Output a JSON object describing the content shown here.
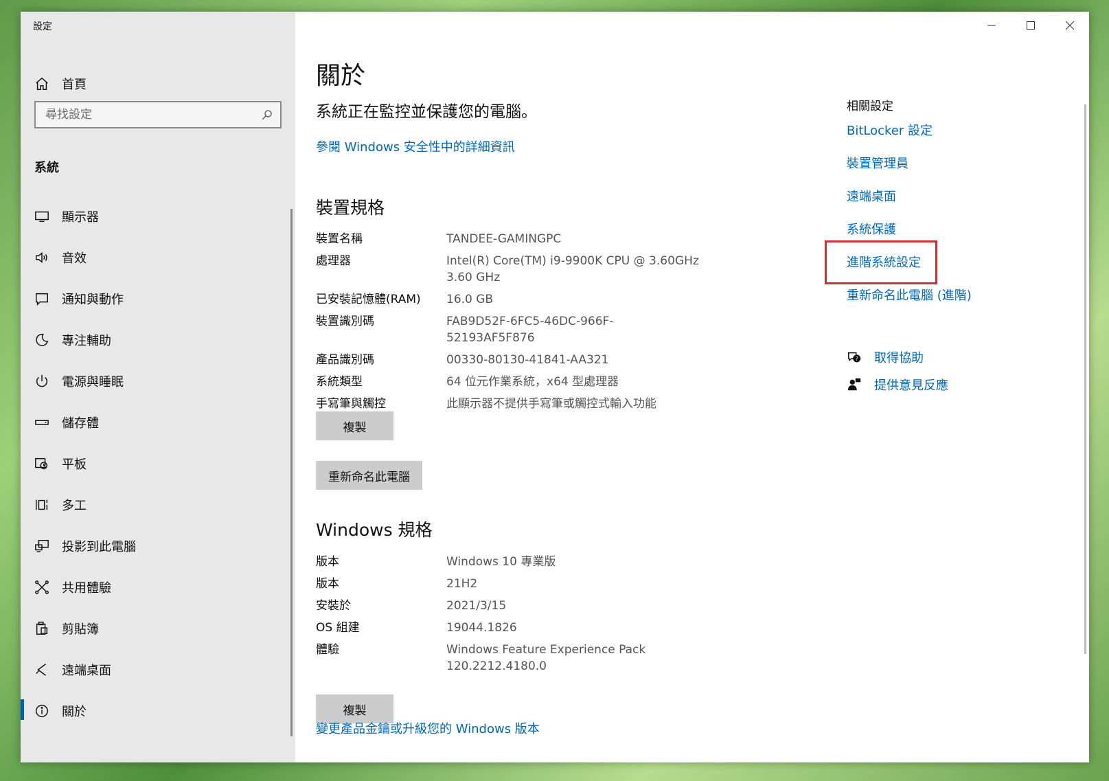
{
  "window": {
    "app_title": "設定",
    "controls": [
      "minimize-icon",
      "maximize-icon",
      "close-icon"
    ]
  },
  "sidebar": {
    "home_label": "首頁",
    "search_placeholder": "尋找設定",
    "section_title": "系統",
    "items": [
      {
        "label": "顯示器",
        "icon": "monitor-icon"
      },
      {
        "label": "音效",
        "icon": "speaker-icon"
      },
      {
        "label": "通知與動作",
        "icon": "notification-icon"
      },
      {
        "label": "專注輔助",
        "icon": "moon-icon"
      },
      {
        "label": "電源與睡眠",
        "icon": "power-icon"
      },
      {
        "label": "儲存體",
        "icon": "storage-icon"
      },
      {
        "label": "平板",
        "icon": "tablet-icon"
      },
      {
        "label": "多工",
        "icon": "multitask-icon"
      },
      {
        "label": "投影到此電腦",
        "icon": "project-icon"
      },
      {
        "label": "共用體驗",
        "icon": "share-icon"
      },
      {
        "label": "剪貼簿",
        "icon": "clipboard-icon"
      },
      {
        "label": "遠端桌面",
        "icon": "remote-icon"
      },
      {
        "label": "關於",
        "icon": "info-icon",
        "active": true
      }
    ]
  },
  "main": {
    "title": "關於",
    "protect_text": "系統正在監控並保護您的電腦。",
    "security_link": "參閱 Windows 安全性中的詳細資訊",
    "device_specs": {
      "heading": "裝置規格",
      "rows": [
        {
          "key": "裝置名稱",
          "value": "TANDEE-GAMINGPC"
        },
        {
          "key": "處理器",
          "value": "Intel(R) Core(TM) i9-9900K CPU @ 3.60GHz",
          "value2": "3.60 GHz"
        },
        {
          "key": "已安裝記憶體(RAM)",
          "value": "16.0 GB"
        },
        {
          "key": "裝置識別碼",
          "value": "FAB9D52F-6FC5-46DC-966F-52193AF5F876"
        },
        {
          "key": "產品識別碼",
          "value": "00330-80130-41841-AA321"
        },
        {
          "key": "系統類型",
          "value": "64 位元作業系統，x64 型處理器"
        },
        {
          "key": "手寫筆與觸控",
          "value": "此顯示器不提供手寫筆或觸控式輸入功能"
        }
      ],
      "copy_button": "複製",
      "rename_button": "重新命名此電腦"
    },
    "windows_specs": {
      "heading": "Windows 規格",
      "rows": [
        {
          "key": "版本",
          "value": "Windows 10 專業版"
        },
        {
          "key": "版本",
          "value": "21H2"
        },
        {
          "key": "安裝於",
          "value": "2021/3/15"
        },
        {
          "key": "OS 組建",
          "value": "19044.1826"
        },
        {
          "key": "體驗",
          "value": "Windows Feature Experience Pack",
          "value2": "120.2212.4180.0"
        }
      ],
      "copy_button": "複製"
    },
    "bottom_link": "變更產品金鑰或升級您的 Windows 版本"
  },
  "related": {
    "title": "相關設定",
    "links": [
      "BitLocker 設定",
      "裝置管理員",
      "遠端桌面",
      "系統保護",
      "進階系統設定",
      "重新命名此電腦 (進階)"
    ],
    "highlighted": "進階系統設定",
    "help_links": [
      {
        "label": "取得協助",
        "icon": "help-chat-icon"
      },
      {
        "label": "提供意見反應",
        "icon": "feedback-icon"
      }
    ]
  },
  "colors": {
    "accent": "#0067b8",
    "highlight_border": "#d32f2f",
    "sidebar_bg": "#e8e8e8",
    "button_bg": "#cccccc"
  }
}
